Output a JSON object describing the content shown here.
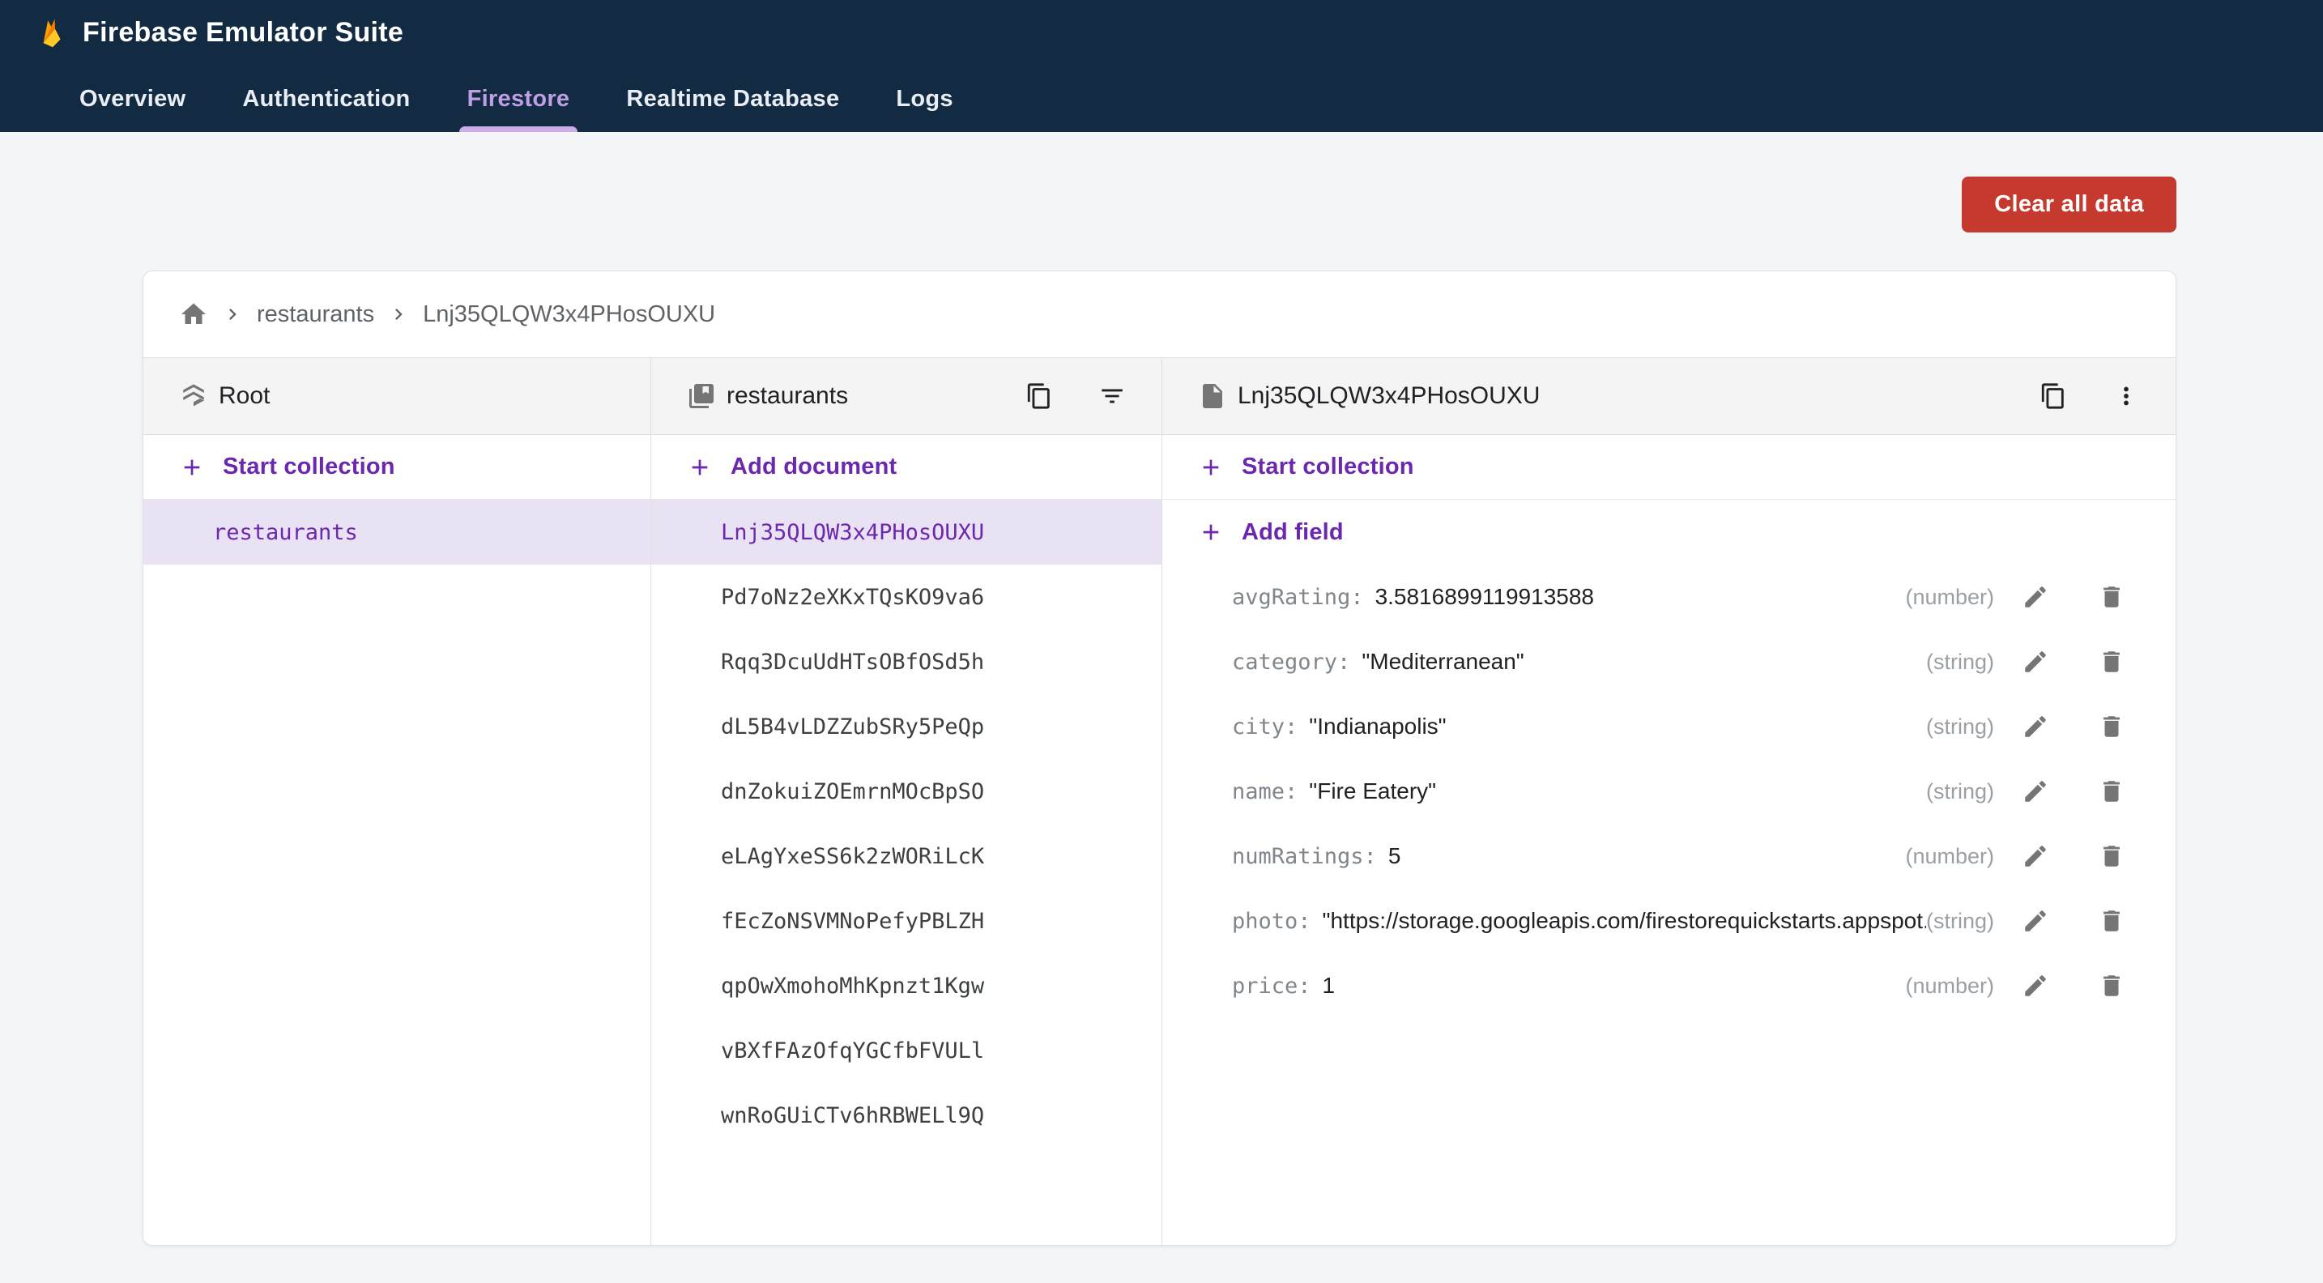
{
  "nav": {
    "title": "Firebase Emulator Suite",
    "tabs": [
      {
        "label": "Overview",
        "active": false
      },
      {
        "label": "Authentication",
        "active": false
      },
      {
        "label": "Firestore",
        "active": true
      },
      {
        "label": "Realtime Database",
        "active": false
      },
      {
        "label": "Logs",
        "active": false
      }
    ]
  },
  "toolbar": {
    "clear_all_label": "Clear all data"
  },
  "breadcrumb": {
    "collection": "restaurants",
    "document": "Lnj35QLQW3x4PHosOUXU"
  },
  "panels": {
    "root": {
      "title": "Root",
      "start_collection_label": "Start collection",
      "collections": [
        "restaurants"
      ],
      "selected_collection": "restaurants"
    },
    "collection": {
      "title": "restaurants",
      "add_document_label": "Add document",
      "selected_document": "Lnj35QLQW3x4PHosOUXU",
      "documents": [
        "Lnj35QLQW3x4PHosOUXU",
        "Pd7oNz2eXKxTQsKO9va6",
        "Rqq3DcuUdHTsOBfOSd5h",
        "dL5B4vLDZZubSRy5PeQp",
        "dnZokuiZOEmrnMOcBpSO",
        "eLAgYxeSS6k2zWORiLcK",
        "fEcZoNSVMNoPefyPBLZH",
        "qpOwXmohoMhKpnzt1Kgw",
        "vBXfFAzOfqYGCfbFVULl",
        "wnRoGUiCTv6hRBWELl9Q"
      ]
    },
    "document": {
      "title": "Lnj35QLQW3x4PHosOUXU",
      "start_collection_label": "Start collection",
      "add_field_label": "Add field",
      "fields": [
        {
          "name": "avgRating:",
          "value": "3.5816899119913588",
          "type": "(number)"
        },
        {
          "name": "category:",
          "value": "\"Mediterranean\"",
          "type": "(string)"
        },
        {
          "name": "city:",
          "value": "\"Indianapolis\"",
          "type": "(string)"
        },
        {
          "name": "name:",
          "value": "\"Fire Eatery\"",
          "type": "(string)"
        },
        {
          "name": "numRatings:",
          "value": "5",
          "type": "(number)"
        },
        {
          "name": "photo:",
          "value": "\"https://storage.googleapis.com/firestorequickstarts.appspot....",
          "type": "(string)"
        },
        {
          "name": "price:",
          "value": "1",
          "type": "(number)"
        }
      ]
    }
  },
  "colors": {
    "nav_background": "#132b42",
    "tab_active": "#bf9fe3",
    "tab_indicator": "#c9aee9",
    "accent_purple": "#6b27ad",
    "selected_row_background": "#e9e2f5",
    "danger_red": "#c5392e",
    "flame_yellow": "#ffca28",
    "flame_orange": "#f57c00",
    "flame_amber": "#ffa000"
  }
}
